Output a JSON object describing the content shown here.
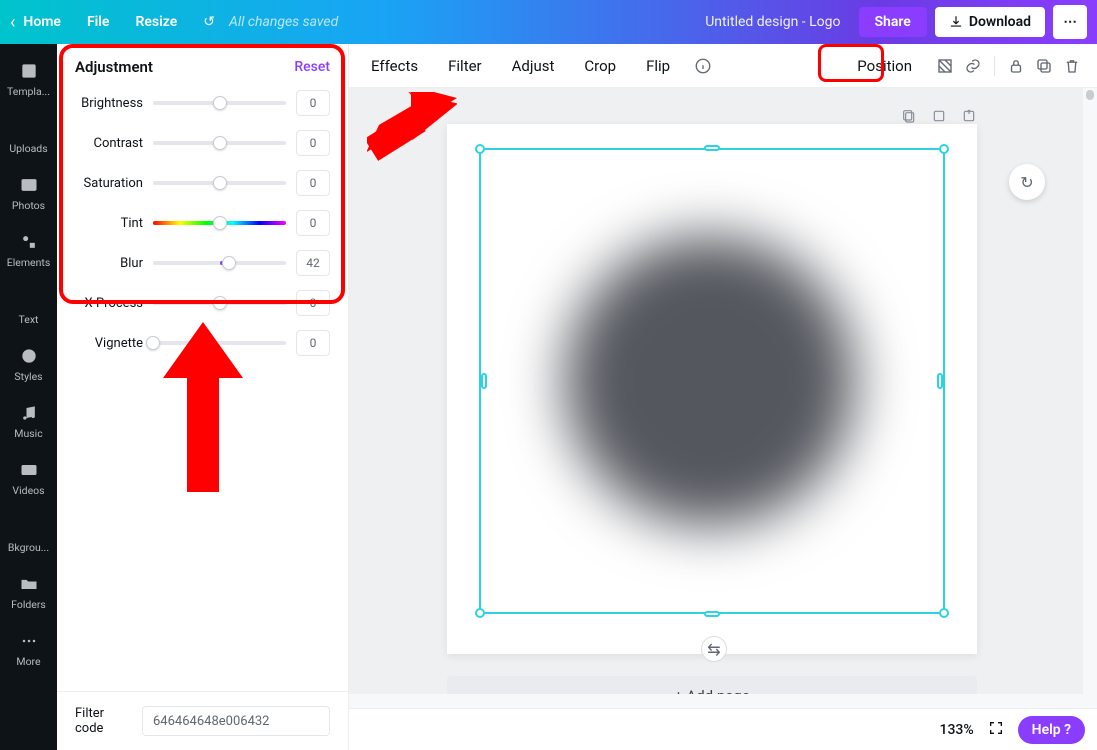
{
  "topbar": {
    "home": "Home",
    "file": "File",
    "resize": "Resize",
    "status": "All changes saved",
    "doc_title": "Untitled design - Logo",
    "share": "Share",
    "download": "Download"
  },
  "rail": {
    "items": [
      {
        "label": "Templa..."
      },
      {
        "label": "Uploads"
      },
      {
        "label": "Photos"
      },
      {
        "label": "Elements"
      },
      {
        "label": "Text"
      },
      {
        "label": "Styles"
      },
      {
        "label": "Music"
      },
      {
        "label": "Videos"
      },
      {
        "label": "Bkgrou..."
      },
      {
        "label": "Folders"
      },
      {
        "label": "More"
      }
    ]
  },
  "panel": {
    "title": "Adjustment",
    "reset": "Reset",
    "sliders": [
      {
        "label": "Brightness",
        "value": "0",
        "pos": 50
      },
      {
        "label": "Contrast",
        "value": "0",
        "pos": 50
      },
      {
        "label": "Saturation",
        "value": "0",
        "pos": 50
      },
      {
        "label": "Tint",
        "value": "0",
        "pos": 50,
        "tint": true
      },
      {
        "label": "Blur",
        "value": "42",
        "pos": 57,
        "fill_from": 50,
        "fill_to": 57
      },
      {
        "label": "X-Process",
        "value": "0",
        "pos": 50
      },
      {
        "label": "Vignette",
        "value": "0",
        "pos": 0
      }
    ],
    "filter_code_label": "Filter code",
    "filter_code_value": "646464648e006432"
  },
  "toolbar": {
    "effects": "Effects",
    "filter": "Filter",
    "adjust": "Adjust",
    "crop": "Crop",
    "flip": "Flip",
    "position": "Position"
  },
  "canvas": {
    "add_page": "+ Add page"
  },
  "bottom": {
    "zoom": "133%",
    "help": "Help ?"
  }
}
